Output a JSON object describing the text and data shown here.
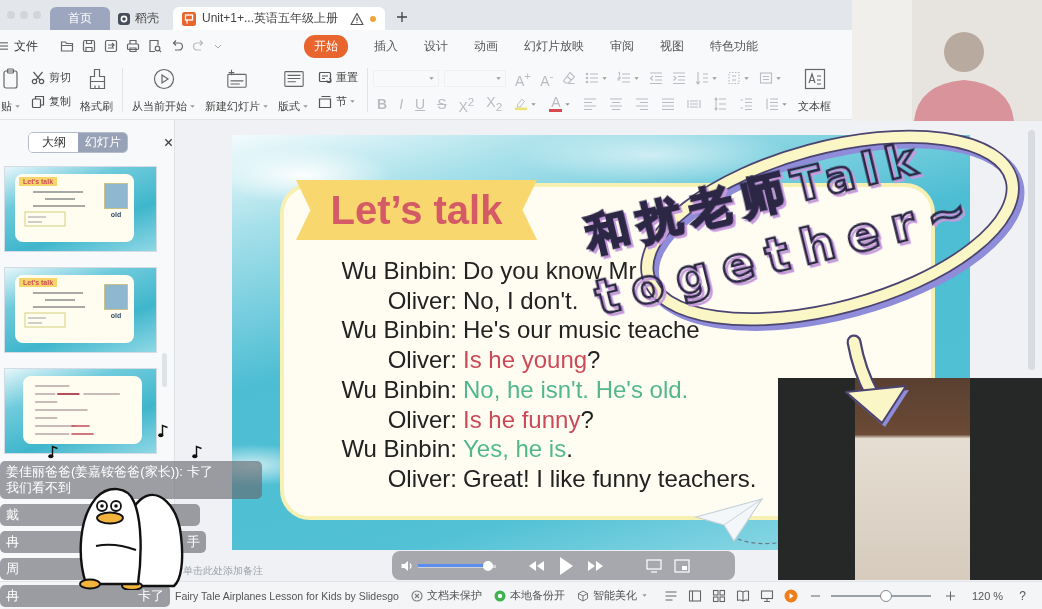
{
  "window_tabs": [
    {
      "label": "首页",
      "kind": "home",
      "selected": false
    },
    {
      "label": "稻壳",
      "kind": "docer",
      "selected": false
    },
    {
      "label": "Unit+1+...英语五年级上册",
      "kind": "document",
      "selected": true,
      "unsaved": true
    }
  ],
  "menu": {
    "file": "文件",
    "tabs": [
      {
        "label": "开始",
        "selected": true
      },
      {
        "label": "插入",
        "selected": false
      },
      {
        "label": "设计",
        "selected": false
      },
      {
        "label": "动画",
        "selected": false
      },
      {
        "label": "幻灯片放映",
        "selected": false
      },
      {
        "label": "审阅",
        "selected": false
      },
      {
        "label": "视图",
        "selected": false
      },
      {
        "label": "特色功能",
        "selected": false
      }
    ]
  },
  "ribbon": {
    "groups": [
      {
        "items": [
          {
            "kind": "paste",
            "label": "贴",
            "dropdown": true
          }
        ]
      },
      {
        "items": [
          {
            "kind": "cut",
            "label": "剪切",
            "dropdown": false
          },
          {
            "kind": "copy",
            "label": "复制",
            "dropdown": false
          }
        ]
      },
      {
        "items": [
          {
            "kind": "format-painter",
            "label": "格式刷",
            "dropdown": false
          }
        ]
      },
      {
        "items": [
          {
            "kind": "play",
            "label": "从当前开始",
            "dropdown": true
          }
        ]
      },
      {
        "items": [
          {
            "kind": "new-slide",
            "label": "新建幻灯片",
            "dropdown": true
          }
        ]
      },
      {
        "items": [
          {
            "kind": "layout",
            "label": "版式",
            "dropdown": true
          }
        ]
      },
      {
        "items": [
          {
            "kind": "reset",
            "label": "重置",
            "dropdown": false
          },
          {
            "kind": "section",
            "label": "节",
            "dropdown": true
          }
        ]
      }
    ],
    "font_size_buttons": [
      {
        "label": "A$^{+}$",
        "disabled": true
      },
      {
        "label": "A$^{-}$",
        "disabled": true
      }
    ],
    "format_buttons": [
      {
        "label": "B",
        "kind": "bold",
        "disabled": true
      },
      {
        "label": "I",
        "kind": "italic",
        "disabled": true
      },
      {
        "label": "U",
        "kind": "underline",
        "disabled": true
      },
      {
        "label": "S",
        "kind": "strike",
        "disabled": true
      },
      {
        "label": "X$^{2}$",
        "kind": "superscript",
        "disabled": true
      },
      {
        "label": "X$_{2}$",
        "kind": "subscript",
        "disabled": true
      }
    ],
    "font_color": {
      "label": "A",
      "disabled": true
    },
    "textbox": "文本框"
  },
  "slides_panel": {
    "tabs": [
      {
        "label": "大纲",
        "selected": false
      },
      {
        "label": "幻灯片",
        "selected": true
      }
    ],
    "thumbnails": [
      {
        "kind": "dialogue",
        "title": "Let's talk",
        "caption": "old"
      },
      {
        "kind": "dialogue",
        "title": "Let's talk",
        "caption": "old"
      },
      {
        "kind": "notes"
      }
    ]
  },
  "slide": {
    "title": "Let’s talk",
    "dialogue": [
      {
        "speaker": "Wu Binbin:",
        "parts": [
          {
            "text": "Do you know Mr",
            "kind": "plain"
          }
        ]
      },
      {
        "speaker": "Oliver:",
        "parts": [
          {
            "text": "No, I don't.",
            "kind": "plain"
          }
        ]
      },
      {
        "speaker": "Wu Binbin:",
        "parts": [
          {
            "text": "He's our music teache",
            "kind": "plain"
          }
        ]
      },
      {
        "speaker": "Oliver:",
        "parts": [
          {
            "text": "Is he young",
            "kind": "question"
          },
          {
            "text": "?",
            "kind": "plain"
          }
        ]
      },
      {
        "speaker": "Wu Binbin:",
        "parts": [
          {
            "text": "No, he isn't. He's old.",
            "kind": "answer"
          }
        ]
      },
      {
        "speaker": "Oliver:",
        "parts": [
          {
            "text": "Is he funny",
            "kind": "question"
          },
          {
            "text": "?",
            "kind": "plain"
          }
        ]
      },
      {
        "speaker": "Wu Binbin:",
        "parts": [
          {
            "text": "Yes, he is",
            "kind": "answer"
          },
          {
            "text": ".",
            "kind": "plain"
          }
        ]
      },
      {
        "speaker": "Oliver:",
        "parts": [
          {
            "text": "Great! I like funny teachers.",
            "kind": "plain"
          }
        ]
      }
    ]
  },
  "sticker": {
    "lines": [
      "和扰老师Talk",
      "together~"
    ]
  },
  "chat": [
    {
      "lines": [
        "姜佳丽爸爸(姜嘉铵爸爸(家长)): 卡了",
        "我们看不到"
      ]
    },
    {
      "lines": [
        "戴"
      ]
    },
    {
      "lines": [
        "冉"
      ],
      "tail": "手"
    },
    {
      "lines": [
        "周"
      ]
    },
    {
      "lines": [
        "冉"
      ],
      "tail": "卡了"
    }
  ],
  "notes": {
    "placeholder": "单击此处添加备注"
  },
  "status_bar": {
    "template": "Fairy Tale Airplanes Lesson for Kids by Slidesgo",
    "protection": "文档未保护",
    "backup": "本地备份开",
    "beautify": "智能美化",
    "zoom": {
      "level": 0.55,
      "reading": "120 %"
    },
    "help": "?"
  },
  "player": {
    "volume": {
      "level": 0.9
    }
  }
}
